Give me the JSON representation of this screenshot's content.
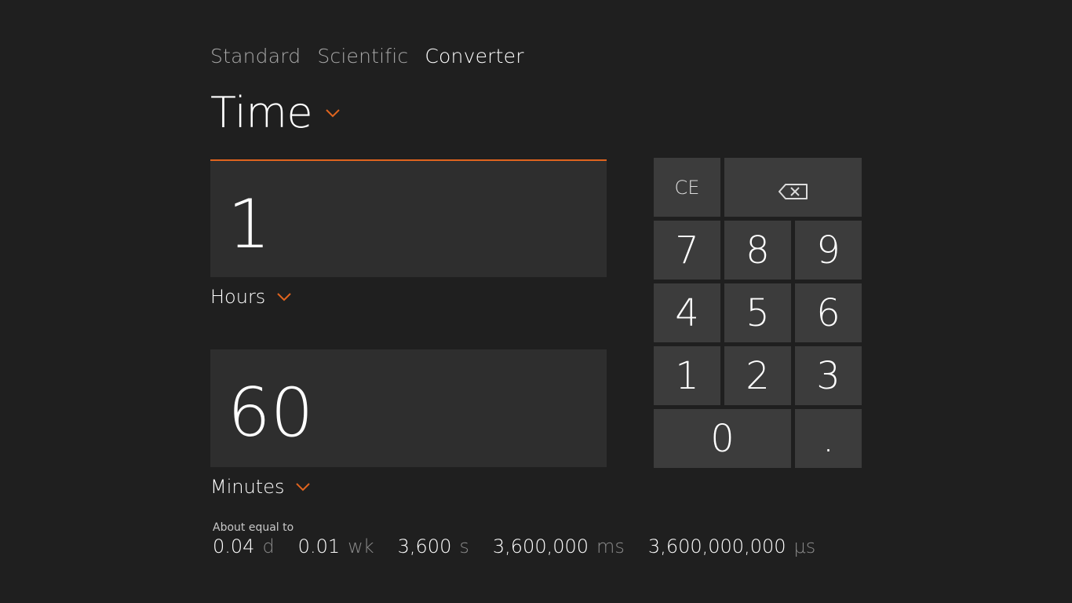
{
  "tabs": [
    {
      "label": "Standard",
      "active": false
    },
    {
      "label": "Scientific",
      "active": false
    },
    {
      "label": "Converter",
      "active": true
    }
  ],
  "category": {
    "label": "Time",
    "icon": "chevron-down-icon"
  },
  "input": {
    "value": "1",
    "unit": "Hours"
  },
  "output": {
    "value": "60",
    "unit": "Minutes"
  },
  "equivalents": {
    "label": "About equal to",
    "items": [
      {
        "value": "0.04",
        "unit": "d"
      },
      {
        "value": "0.01",
        "unit": "wk"
      },
      {
        "value": "3,600",
        "unit": "s"
      },
      {
        "value": "3,600,000",
        "unit": "ms"
      },
      {
        "value": "3,600,000,000",
        "unit": "μs"
      }
    ]
  },
  "keypad": {
    "ce": "CE",
    "backspace_icon": "backspace-icon",
    "k7": "7",
    "k8": "8",
    "k9": "9",
    "k4": "4",
    "k5": "5",
    "k6": "6",
    "k1": "1",
    "k2": "2",
    "k3": "3",
    "k0": "0",
    "dot": "."
  },
  "colors": {
    "background": "#1f1f1f",
    "accent": "#e0641e",
    "box": "#2e2e2e",
    "key": "#3c3c3c"
  }
}
